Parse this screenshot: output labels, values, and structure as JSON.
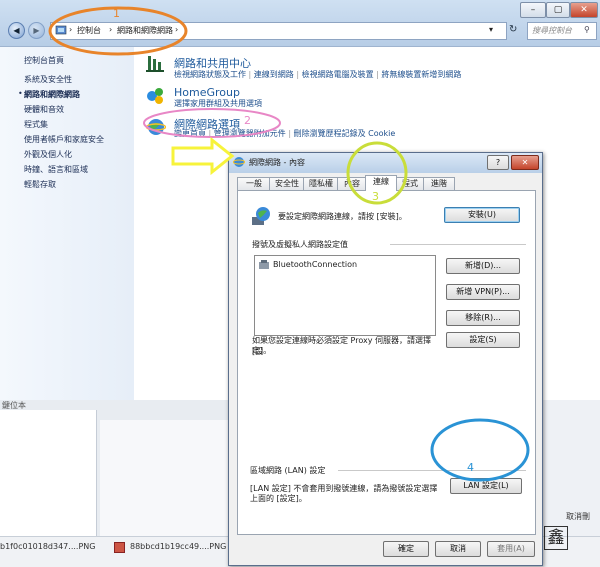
{
  "explorer": {
    "back_symbol": "◀",
    "forward_symbol": "▶",
    "breadcrumb": [
      "控制台",
      "網路和網際網路"
    ],
    "refresh_symbol": "↻",
    "search_placeholder": "搜尋控制台",
    "window_controls": [
      "–",
      "▢",
      "✕"
    ],
    "sidebar": [
      "控制台首頁",
      "系統及安全性",
      "網路和網際網路",
      "硬體和音效",
      "程式集",
      "使用者帳戶和家庭安全",
      "外觀及個人化",
      "時鐘、語言和區域",
      "輕鬆存取"
    ],
    "categories": [
      {
        "title": "網路和共用中心",
        "links": [
          "檢視網路狀態及工作",
          "連線到網路",
          "檢視網路電腦及裝置",
          "將無線裝置新增到網路"
        ]
      },
      {
        "title": "HomeGroup",
        "links": [
          "選擇家用群組及共用選項"
        ]
      },
      {
        "title": "網際網路選項",
        "links": [
          "變更首頁",
          "管理瀏覽器附加元件",
          "刪除瀏覽歷程記錄及 Cookie"
        ]
      }
    ]
  },
  "background": {
    "left_fragment": "鍵位本",
    "taskbar_items": [
      "b1f0c01018d347....PNG",
      "88bbcd1b19cc49....PNG"
    ],
    "right_fragment": "取消刪"
  },
  "dialog": {
    "title": "網際網路 - 內容",
    "help_symbol": "?",
    "close_symbol": "✕",
    "tabs": [
      "一般",
      "安全性",
      "隱私權",
      "內容",
      "連線",
      "程式",
      "進階"
    ],
    "setup_text": "要設定網際網路連線，請按 [安裝]。",
    "setup_button": "安裝(U)",
    "dialup_section": "撥號及虛擬私人網路設定值",
    "connections": [
      "BluetoothConnection"
    ],
    "add_button": "新增(D)...",
    "add_vpn_button": "新增 VPN(P)...",
    "remove_button": "移除(R)...",
    "settings_button": "設定(S)",
    "proxy_text_1": "如果您設定連線時必須設定 Proxy 伺服器，請選擇 [設",
    "proxy_text_2": "定]。",
    "lan_section": "區域網路 (LAN) 設定",
    "lan_text_1": "[LAN 設定] 不會套用到撥號連線，請為撥號設定選擇",
    "lan_text_2": "上面的 [設定]。",
    "lan_button": "LAN 設定(L)",
    "ok_button": "確定",
    "cancel_button": "取消",
    "apply_button": "套用(A)"
  },
  "annotations": {
    "step_numbers": [
      "1",
      "2",
      "3",
      "4"
    ],
    "colors": {
      "step1": "#e8842a",
      "step2": "#e887c6",
      "step3": "#c9dd3a",
      "step4": "#2a93d5",
      "arrow": "#f7f33b"
    }
  },
  "watermark": {
    "glyph": "鑫"
  }
}
